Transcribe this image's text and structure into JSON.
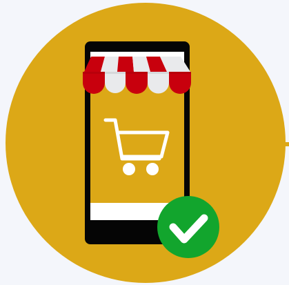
{
  "illustration": {
    "colors": {
      "background": "#f4f6fb",
      "circle": "#dca817",
      "phone_body": "#050505",
      "screen_frame": "#ffffff",
      "screen_fill": "#dca817",
      "cart": "#ffffff",
      "awning_red": "#c8000d",
      "awning_white": "#e9eaec",
      "badge": "#12a52d",
      "check": "#ffffff",
      "connector": "#dca817"
    },
    "icons": {
      "main": "mobile-shop-icon",
      "cart": "shopping-cart-icon",
      "awning": "store-awning-icon",
      "badge": "check-badge-icon"
    }
  }
}
